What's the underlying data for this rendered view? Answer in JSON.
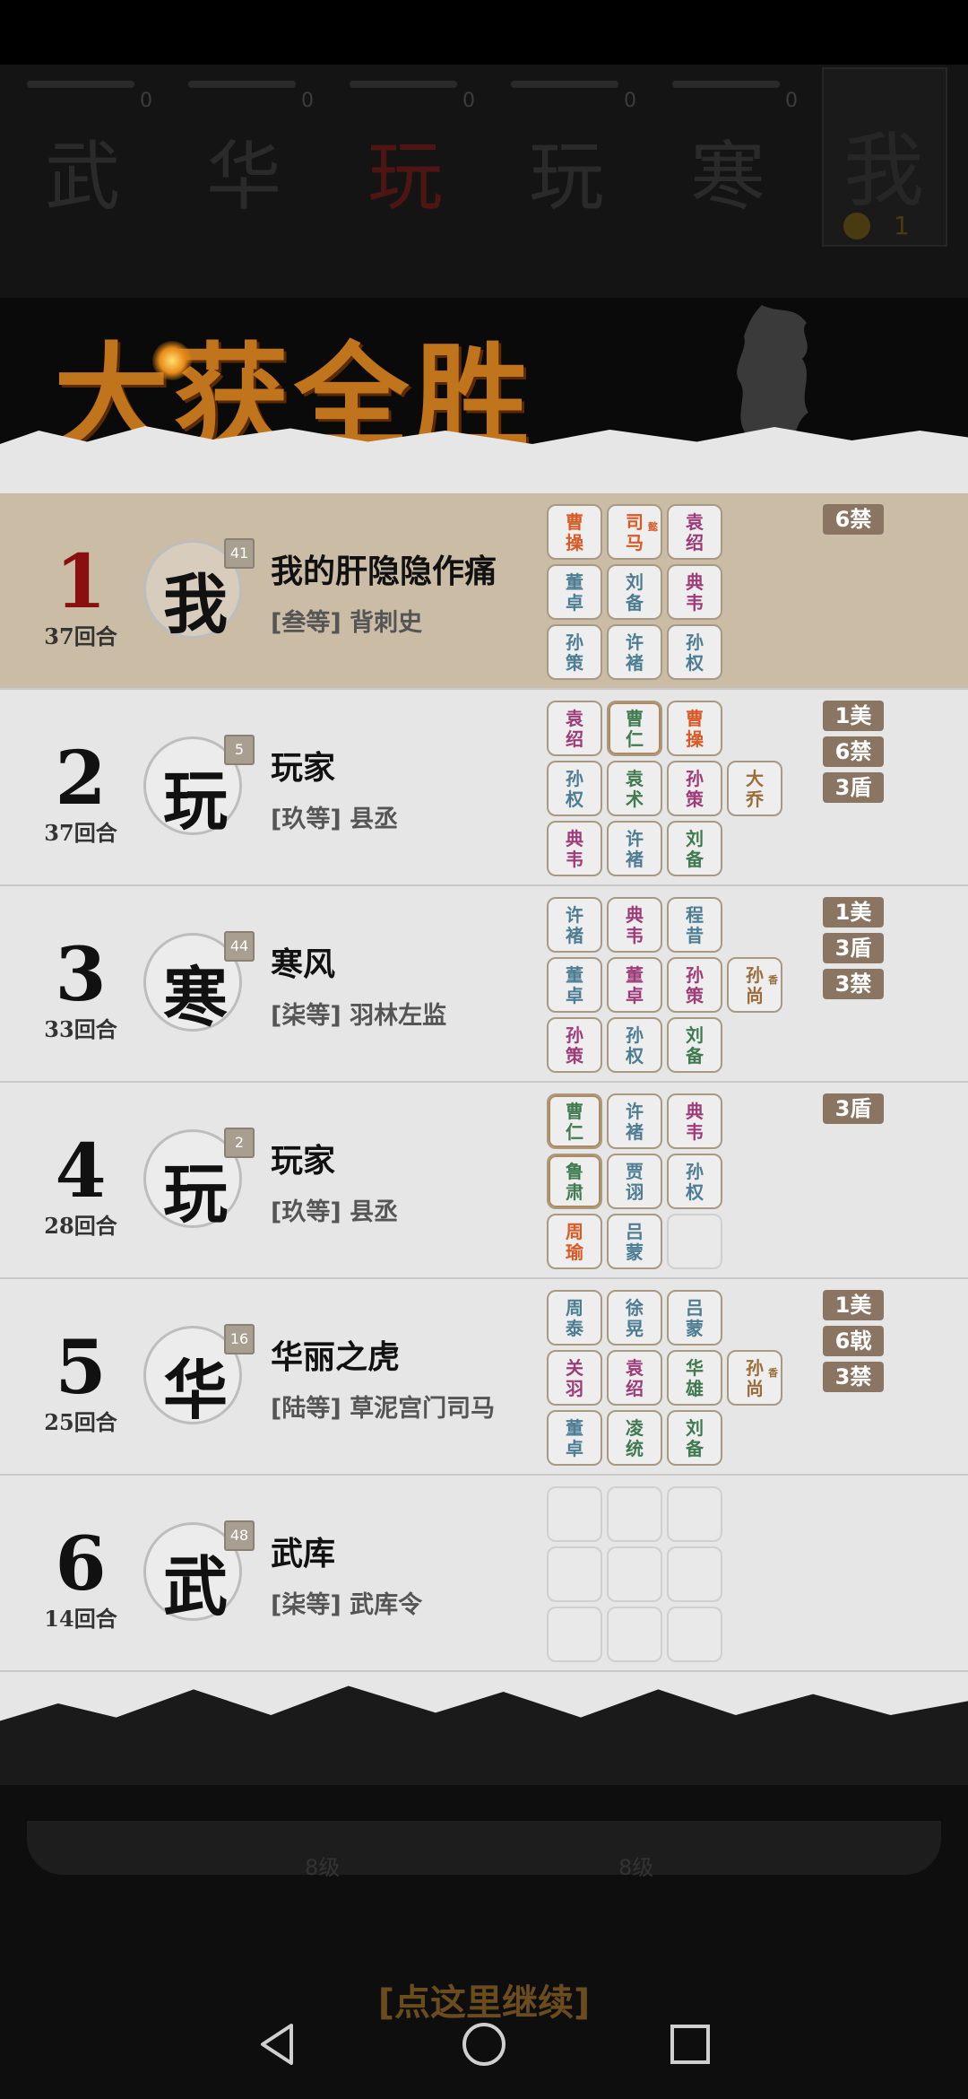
{
  "backdrop": {
    "players": [
      {
        "char": "武",
        "count": "0"
      },
      {
        "char": "华",
        "count": "0"
      },
      {
        "char": "玩",
        "count": "0"
      },
      {
        "char": "玩",
        "count": "0"
      },
      {
        "char": "寒",
        "count": "0"
      }
    ],
    "self": {
      "char": "我",
      "coins": "1"
    }
  },
  "title": "大获全胜",
  "rows": [
    {
      "rank": "1",
      "turns": "37回合",
      "avatar": "我",
      "level": "41",
      "name": "我的肝隐隐作痛",
      "title": "[叁等] 背刺史",
      "tags": [
        "6禁"
      ],
      "cards": [
        {
          "t": "曹操",
          "c": "red"
        },
        {
          "t": "司马",
          "c": "red",
          "sub": "懿"
        },
        {
          "t": "袁绍",
          "c": "purple"
        },
        {
          "t": "董卓",
          "c": "blue"
        },
        {
          "t": "刘备",
          "c": "blue"
        },
        {
          "t": "典韦",
          "c": "purple"
        },
        {
          "t": "孙策",
          "c": "blue"
        },
        {
          "t": "许褚",
          "c": "blue"
        },
        {
          "t": "孙权",
          "c": "blue"
        }
      ],
      "extra": null
    },
    {
      "rank": "2",
      "turns": "37回合",
      "avatar": "玩",
      "level": "5",
      "name": "玩家",
      "title": "[玖等] 县丞",
      "tags": [
        "1美",
        "6禁",
        "3盾"
      ],
      "cards": [
        {
          "t": "袁绍",
          "c": "purple"
        },
        {
          "t": "曹仁",
          "c": "green",
          "ring": true
        },
        {
          "t": "曹操",
          "c": "red"
        },
        {
          "t": "孙权",
          "c": "blue"
        },
        {
          "t": "袁术",
          "c": "green"
        },
        {
          "t": "孙策",
          "c": "purple"
        },
        {
          "t": "典韦",
          "c": "purple"
        },
        {
          "t": "许褚",
          "c": "blue"
        },
        {
          "t": "刘备",
          "c": "green"
        }
      ],
      "extra": {
        "t": "大乔",
        "c": "brown"
      }
    },
    {
      "rank": "3",
      "turns": "33回合",
      "avatar": "寒",
      "level": "44",
      "name": "寒风",
      "title": "[柒等] 羽林左监",
      "tags": [
        "1美",
        "3盾",
        "3禁"
      ],
      "cards": [
        {
          "t": "许褚",
          "c": "blue"
        },
        {
          "t": "典韦",
          "c": "purple"
        },
        {
          "t": "程昔",
          "c": "blue"
        },
        {
          "t": "董卓",
          "c": "blue"
        },
        {
          "t": "董卓",
          "c": "purple"
        },
        {
          "t": "孙策",
          "c": "purple"
        },
        {
          "t": "孙策",
          "c": "purple"
        },
        {
          "t": "孙权",
          "c": "blue"
        },
        {
          "t": "刘备",
          "c": "green"
        }
      ],
      "extra": {
        "t": "孙尚",
        "c": "brown",
        "sub": "香"
      }
    },
    {
      "rank": "4",
      "turns": "28回合",
      "avatar": "玩",
      "level": "2",
      "name": "玩家",
      "title": "[玖等] 县丞",
      "tags": [
        "3盾"
      ],
      "cards": [
        {
          "t": "曹仁",
          "c": "green",
          "ring": true
        },
        {
          "t": "许褚",
          "c": "blue"
        },
        {
          "t": "典韦",
          "c": "purple"
        },
        {
          "t": "鲁肃",
          "c": "green",
          "ring": true
        },
        {
          "t": "贾诩",
          "c": "blue"
        },
        {
          "t": "孙权",
          "c": "blue"
        },
        {
          "t": "周瑜",
          "c": "red"
        },
        {
          "t": "吕蒙",
          "c": "blue"
        },
        {
          "t": "",
          "c": "empty"
        }
      ],
      "extra": null
    },
    {
      "rank": "5",
      "turns": "25回合",
      "avatar": "华",
      "level": "16",
      "name": "华丽之虎",
      "title": "[陆等] 草泥宫门司马",
      "tags": [
        "1美",
        "6戟",
        "3禁"
      ],
      "cards": [
        {
          "t": "周泰",
          "c": "blue"
        },
        {
          "t": "徐晃",
          "c": "blue"
        },
        {
          "t": "吕蒙",
          "c": "blue"
        },
        {
          "t": "关羽",
          "c": "purple"
        },
        {
          "t": "袁绍",
          "c": "purple"
        },
        {
          "t": "华雄",
          "c": "green"
        },
        {
          "t": "董卓",
          "c": "blue"
        },
        {
          "t": "凌统",
          "c": "green"
        },
        {
          "t": "刘备",
          "c": "green"
        }
      ],
      "extra": {
        "t": "孙尚",
        "c": "brown",
        "sub": "香"
      }
    },
    {
      "rank": "6",
      "turns": "14回合",
      "avatar": "武",
      "level": "48",
      "name": "武库",
      "title": "[柒等] 武库令",
      "tags": [],
      "cards": [
        {
          "t": "",
          "c": "empty"
        },
        {
          "t": "",
          "c": "empty"
        },
        {
          "t": "",
          "c": "empty"
        },
        {
          "t": "",
          "c": "empty"
        },
        {
          "t": "",
          "c": "empty"
        },
        {
          "t": "",
          "c": "empty"
        },
        {
          "t": "",
          "c": "empty"
        },
        {
          "t": "",
          "c": "empty"
        },
        {
          "t": "",
          "c": "empty"
        }
      ],
      "extra": null
    }
  ],
  "footer": {
    "level_left": "8级",
    "level_right": "8级",
    "continue": "[点这里继续]"
  },
  "nav": {
    "back": "back-icon",
    "home": "home-icon",
    "recents": "recents-icon"
  }
}
